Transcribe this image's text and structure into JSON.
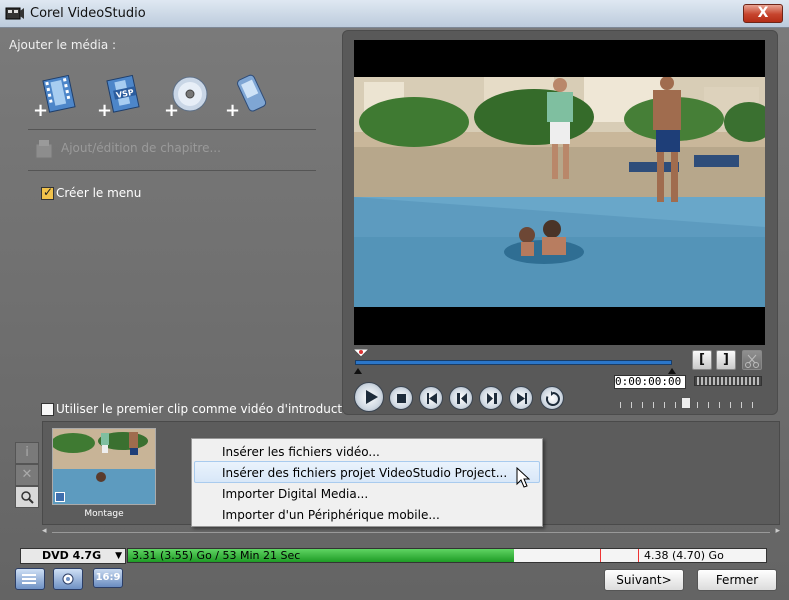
{
  "window": {
    "title": "Corel VideoStudio",
    "close_glyph": "X"
  },
  "media": {
    "label": "Ajouter le média :",
    "icons": [
      "add-video-icon",
      "add-vsp-icon",
      "add-disc-icon",
      "add-mobile-icon"
    ]
  },
  "chapter_label": "Ajout/édition de chapitre...",
  "create_menu": {
    "label": "Créer le menu",
    "checked": true
  },
  "intro": {
    "label": "Utiliser le premier clip comme vidéo d'introduction",
    "checked": false
  },
  "player": {
    "timecode": "0:00:00:00",
    "mark_in": "[",
    "mark_out": "]"
  },
  "clip": {
    "name": "Montage"
  },
  "context_menu": {
    "items": [
      "Insérer les fichiers vidéo...",
      "Insérer des fichiers projet VideoStudio Project...",
      "Importer Digital Media...",
      "Importer d'un Périphérique mobile..."
    ],
    "highlighted_index": 1
  },
  "capacity": {
    "disc_type": "DVD 4.7G",
    "used_text": "3.31 (3.55) Go / 53 Min 21 Sec",
    "limit_text": "4.38 (4.70) Go",
    "used_fraction": 0.605
  },
  "aspect_label": "16:9",
  "buttons": {
    "next": "Suivant>",
    "close": "Fermer"
  },
  "colors": {
    "capacity_fill": "#2fb236",
    "playhead": "#2b76c9",
    "highlight": "#d8e7f8"
  }
}
